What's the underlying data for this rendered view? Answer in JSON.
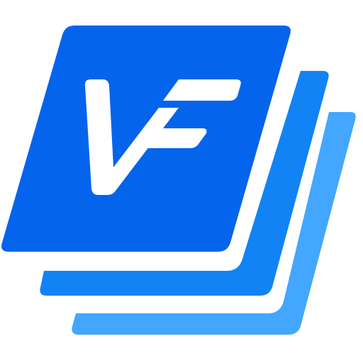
{
  "logo": {
    "wordmark": "VF",
    "icon": "stacked-layers-logo-icon",
    "colors": {
      "front": "#0564EC",
      "middle": "#1183F5",
      "back": "#43A6FF",
      "letters": "#FFFFFF",
      "background": "#FFFFFF"
    }
  }
}
